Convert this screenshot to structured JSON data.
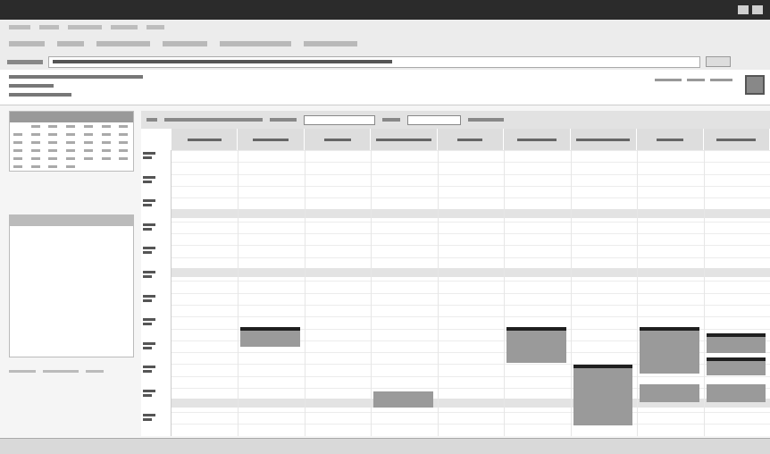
{
  "window": {
    "title": ""
  },
  "menubar": {
    "items": [
      "",
      "",
      "",
      "",
      ""
    ]
  },
  "toolbar": {
    "address_label": "",
    "address_value": "",
    "go_label": ""
  },
  "calendar": {
    "columns": [
      "",
      "",
      "",
      "",
      "",
      "",
      "",
      "",
      ""
    ],
    "events": []
  },
  "colors": {
    "event": "#9a9a9a",
    "event_border": "#1f1f1f",
    "lunch_band": "#e3e3e3"
  }
}
